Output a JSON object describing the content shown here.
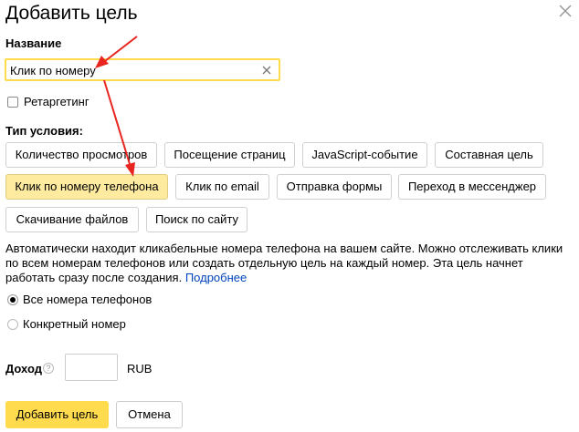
{
  "dialog": {
    "title": "Добавить цель",
    "close_icon": "close-icon"
  },
  "name_section": {
    "label": "Название",
    "value": "Клик по номеру",
    "clear_icon": "clear-icon"
  },
  "retargeting": {
    "label": "Ретаргетинг",
    "checked": false
  },
  "condition_type": {
    "label": "Тип условия:",
    "options": [
      "Количество просмотров",
      "Посещение страниц",
      "JavaScript-событие",
      "Составная цель",
      "Клик по номеру телефона",
      "Клик по email",
      "Отправка формы",
      "Переход в мессенджер",
      "Скачивание файлов",
      "Поиск по сайту"
    ],
    "selected": "Клик по номеру телефона"
  },
  "description": {
    "text": "Автоматически находит кликабельные номера телефона на вашем сайте. Можно отслеживать клики по всем номерам телефонов или создать отдельную цель на каждый номер. Эта цель начнет работать сразу после создания.",
    "link": "Подробнее"
  },
  "phone_scope": {
    "options": [
      "Все номера телефонов",
      "Конкретный номер"
    ],
    "selected": "Все номера телефонов"
  },
  "income": {
    "label": "Доход",
    "help_icon": "help-icon",
    "help_glyph": "?",
    "value": "",
    "currency": "RUB"
  },
  "actions": {
    "submit_label": "Добавить цель",
    "cancel_label": "Отмена"
  },
  "colors": {
    "accent": "#ffdb4d",
    "selected_chip": "#ffeba0",
    "link": "#0044bb",
    "annotation_arrow": "#e8251f"
  }
}
